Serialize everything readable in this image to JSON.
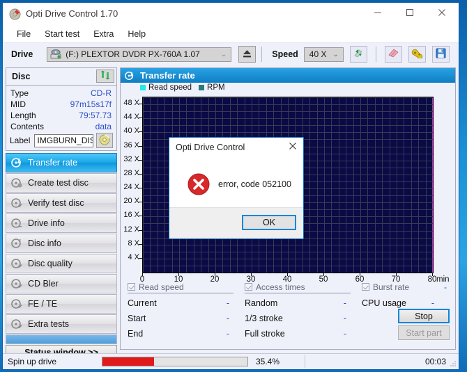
{
  "window": {
    "title": "Opti Drive Control 1.70",
    "icon": "disc-app-icon",
    "minimize": "—",
    "maximize": "▢",
    "close": "✕"
  },
  "menu": {
    "items": [
      {
        "label": "File"
      },
      {
        "label": "Start test"
      },
      {
        "label": "Extra"
      },
      {
        "label": "Help"
      }
    ]
  },
  "toolbar": {
    "drive_label": "Drive",
    "drive_value": "(F:)  PLEXTOR DVDR  PX-760A 1.07",
    "drive_arrow": "⌄",
    "eject_icon": "eject-icon",
    "speed_label": "Speed",
    "speed_value": "40 X",
    "speed_arrow": "⌄",
    "refresh_icon": "refresh-speed-icon",
    "erase_icon": "erase-disc-icon",
    "settings_icon": "plug-settings-icon",
    "save_icon": "save-floppy-icon"
  },
  "disc": {
    "header": "Disc",
    "refresh_icon": "refresh-disc-icon",
    "rows": [
      {
        "key": "Type",
        "value": "CD-R"
      },
      {
        "key": "MID",
        "value": "97m15s17f"
      },
      {
        "key": "Length",
        "value": "79:57.73"
      },
      {
        "key": "Contents",
        "value": "data"
      }
    ],
    "label_key": "Label",
    "label_value": "IMGBURN_DIS",
    "label_btn_icon": "disc-icon"
  },
  "nav": {
    "items": [
      {
        "label": "Transfer rate",
        "icon": "transfer-rate-icon",
        "active": true
      },
      {
        "label": "Create test disc",
        "icon": "create-test-disc-icon",
        "active": false
      },
      {
        "label": "Verify test disc",
        "icon": "verify-test-disc-icon",
        "active": false
      },
      {
        "label": "Drive info",
        "icon": "drive-info-icon",
        "active": false
      },
      {
        "label": "Disc info",
        "icon": "disc-info-icon",
        "active": false
      },
      {
        "label": "Disc quality",
        "icon": "disc-quality-icon",
        "active": false
      },
      {
        "label": "CD Bler",
        "icon": "cd-bler-icon",
        "active": false
      },
      {
        "label": "FE / TE",
        "icon": "fe-te-icon",
        "active": false
      },
      {
        "label": "Extra tests",
        "icon": "extra-tests-icon",
        "active": false
      }
    ],
    "status_window": "Status window >>"
  },
  "panel": {
    "title": "Transfer rate",
    "icon": "transfer-rate-icon"
  },
  "chart_data": {
    "type": "line",
    "title": "Transfer rate",
    "xlabel": "min",
    "ylabel": "X",
    "xlim": [
      0,
      80
    ],
    "ylim": [
      0,
      50
    ],
    "xticks": [
      0,
      10,
      20,
      30,
      40,
      50,
      60,
      70,
      80
    ],
    "xtick_labels": [
      "0",
      "10",
      "20",
      "30",
      "40",
      "50",
      "60",
      "70",
      "80"
    ],
    "x_unit_label": "min",
    "yticks": [
      4,
      8,
      12,
      16,
      20,
      24,
      28,
      32,
      36,
      40,
      44,
      48
    ],
    "ytick_labels": [
      "4 X",
      "8 X",
      "12 X",
      "16 X",
      "20 X",
      "24 X",
      "28 X",
      "32 X",
      "36 X",
      "40 X",
      "44 X",
      "48 X"
    ],
    "grid": true,
    "plot_background": "#0a0a46",
    "grid_color": "#3a3a52",
    "legend_position": "top-left",
    "legend": [
      {
        "name": "Read speed",
        "color": "#22e8f0"
      },
      {
        "name": "RPM",
        "color": "#2a7a7a"
      }
    ],
    "series": [
      {
        "name": "Read speed",
        "color": "#22e8f0",
        "x": [],
        "values": []
      },
      {
        "name": "RPM",
        "color": "#2a7a7a",
        "x": [],
        "values": []
      }
    ],
    "annotations": [
      {
        "type": "vline",
        "x": 80,
        "color": "#c81ec8"
      }
    ]
  },
  "results": {
    "columns": [
      {
        "checkbox_label": "Read speed",
        "checked": true,
        "header_value": "",
        "rows": [
          {
            "key": "Current",
            "value": "-"
          },
          {
            "key": "Start",
            "value": "-"
          },
          {
            "key": "End",
            "value": "-"
          }
        ]
      },
      {
        "checkbox_label": "Access times",
        "checked": true,
        "header_value": "",
        "rows": [
          {
            "key": "Random",
            "value": "-"
          },
          {
            "key": "1/3 stroke",
            "value": "-"
          },
          {
            "key": "Full stroke",
            "value": "-"
          }
        ]
      },
      {
        "checkbox_label": "Burst rate",
        "checked": true,
        "header_value": "-",
        "rows": [
          {
            "key": "CPU usage",
            "value": "-"
          }
        ]
      }
    ],
    "stop_button": "Stop",
    "start_part_button": "Start part"
  },
  "statusbar": {
    "text": "Spin up drive",
    "progress_percent": 35.4,
    "progress_label": "35.4%",
    "elapsed": "00:03",
    "progress_color": "#e01b1b"
  },
  "dialog": {
    "title": "Opti Drive Control",
    "close": "✕",
    "icon": "error-x-icon",
    "message": "error, code 052100",
    "ok_button": "OK"
  }
}
